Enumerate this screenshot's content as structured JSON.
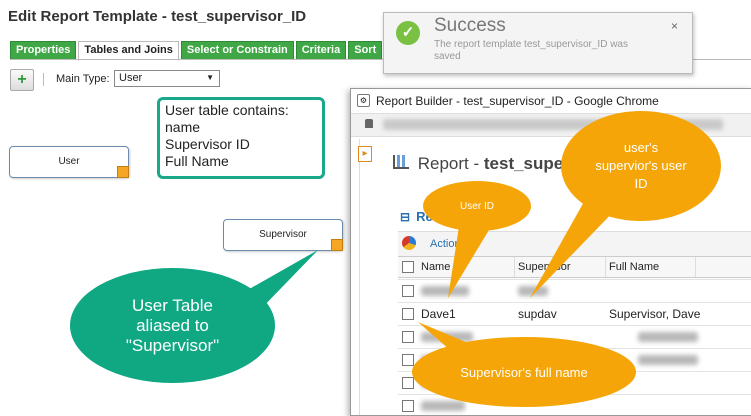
{
  "page": {
    "title": "Edit Report Template - test_supervisor_ID"
  },
  "tabs": [
    "Properties",
    "Tables and Joins",
    "Select or Constrain",
    "Criteria",
    "Sort"
  ],
  "active_tab_index": 1,
  "toolbar": {
    "add_icon": "plus-icon",
    "main_type_label": "Main Type:",
    "main_type_value": "User"
  },
  "nodes": {
    "user": "User",
    "supervisor": "Supervisor"
  },
  "callouts": {
    "user_table_info": [
      "User table contains:",
      "name",
      "Supervisor ID",
      "Full Name"
    ],
    "alias": [
      "User Table",
      "aliased to",
      "\"Supervisor\""
    ],
    "user_id": "User ID",
    "supervisor_user_id": [
      "user's",
      "supervior's user",
      "ID"
    ],
    "supervisor_full_name": "Supervisor's full name"
  },
  "notification": {
    "title": "Success",
    "message": "The report template test_supervisor_ID was saved",
    "close": "×",
    "icon": "check-icon"
  },
  "browser": {
    "title": "Report Builder - test_supervisor_ID - Google Chrome",
    "report_label": "Report - ",
    "report_name": "test_superv",
    "section": "Results Tab",
    "actions": "Actions",
    "columns": [
      "Name",
      "Supervisor",
      "Full Name"
    ],
    "rows": [
      {
        "name": "",
        "supervisor": "",
        "full_name": ""
      },
      {
        "name": "Dave1",
        "supervisor": "supdav",
        "full_name": "Supervisor, Dave"
      },
      {
        "name": "",
        "supervisor": "",
        "full_name": ""
      },
      {
        "name": "",
        "supervisor": "",
        "full_name": ""
      },
      {
        "name": "",
        "supervisor": "",
        "full_name": ""
      },
      {
        "name": "",
        "supervisor": "",
        "full_name": ""
      }
    ]
  },
  "colors": {
    "tab_green": "#3fa745",
    "teal": "#0fa883",
    "orange": "#f5a507",
    "success_green": "#7ac143"
  }
}
